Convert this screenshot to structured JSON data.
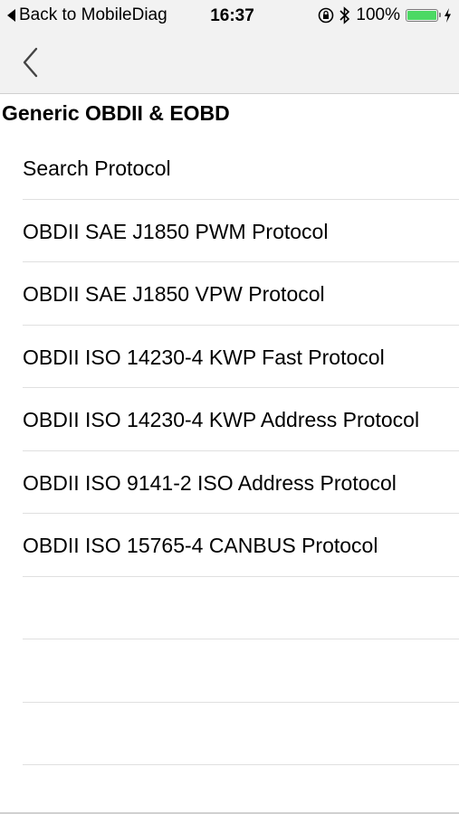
{
  "status_bar": {
    "back_label": "Back to MobileDiag",
    "time": "16:37",
    "battery_percent": "100%",
    "battery_level": 1.0,
    "battery_color": "#4cd964"
  },
  "nav": {
    "back_icon": "chevron-left-icon"
  },
  "section": {
    "title": "Generic OBDII & EOBD"
  },
  "protocols": [
    "Search Protocol",
    "OBDII SAE J1850 PWM Protocol",
    "OBDII SAE J1850 VPW Protocol",
    "OBDII ISO 14230-4 KWP Fast Protocol",
    "OBDII ISO 14230-4 KWP Address Protocol",
    "OBDII ISO 9141-2 ISO Address Protocol",
    "OBDII ISO 15765-4 CANBUS Protocol"
  ]
}
